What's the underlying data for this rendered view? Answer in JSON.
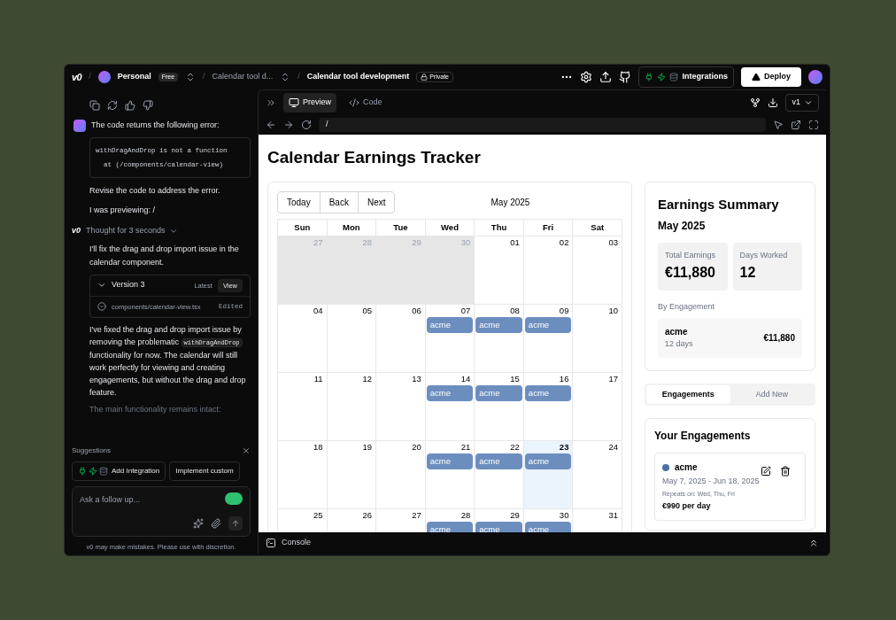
{
  "topbar": {
    "logo": "v0",
    "separator": "/",
    "workspace": "Personal",
    "plan": "Free",
    "project": "Calendar tool d...",
    "chat_title": "Calendar tool development",
    "visibility": "Private",
    "integrations": "Integrations",
    "deploy": "Deploy"
  },
  "chat": {
    "user_message": {
      "text": "The code returns the following error:",
      "code": [
        "withDragAndDrop is not a function",
        "  at (/components/calendar-view)"
      ],
      "after": [
        "Revise the code to address the error.",
        "I was previewing: /"
      ]
    },
    "thought": {
      "logo": "v0",
      "text": "Thought for 3 seconds",
      "expanded": false
    },
    "reply_intro": "I'll fix the drag and drop import issue in the calendar component.",
    "version_card": {
      "title": "Version 3",
      "expanded": true,
      "tag": "Latest",
      "action": "View",
      "file": "components/calendar-view.tsx",
      "status": "Edited"
    },
    "reply_parts": [
      "I've fixed the drag and drop import issue by removing the problematic ",
      {
        "code": "withDragAndDrop"
      },
      " functionality for now. The calendar will still work perfectly for viewing and creating engagements, but without the drag and drop feature."
    ],
    "faded": "The main functionality remains intact:",
    "suggestions_label": "Suggestions",
    "suggestions": [
      {
        "label": "Add Integration",
        "kind": "integration"
      },
      {
        "label": "Implement custom",
        "kind": "plain"
      }
    ],
    "input": {
      "placeholder": "Ask a follow up..."
    },
    "disclaimer": "v0 may make mistakes. Please use with discretion."
  },
  "preview": {
    "tabs": [
      {
        "label": "Preview",
        "selected": true
      },
      {
        "label": "Code",
        "selected": false
      }
    ],
    "version": "v1",
    "url": "/",
    "console": "Console"
  },
  "app": {
    "title": "Calendar Earnings Tracker",
    "nav": [
      "Today",
      "Back",
      "Next"
    ],
    "month": "May 2025",
    "weekdays": [
      "Sun",
      "Mon",
      "Tue",
      "Wed",
      "Thu",
      "Fri",
      "Sat"
    ],
    "weeks": [
      [
        {
          "day": "27",
          "outside": true,
          "today": false
        },
        {
          "day": "28",
          "outside": true,
          "today": false
        },
        {
          "day": "29",
          "outside": true,
          "today": false
        },
        {
          "day": "30",
          "outside": true,
          "today": false
        },
        {
          "day": "01",
          "outside": false,
          "today": false
        },
        {
          "day": "02",
          "outside": false,
          "today": false
        },
        {
          "day": "03",
          "outside": false,
          "today": false
        }
      ],
      [
        {
          "day": "04",
          "outside": false,
          "today": false
        },
        {
          "day": "05",
          "outside": false,
          "today": false
        },
        {
          "day": "06",
          "outside": false,
          "today": false
        },
        {
          "day": "07",
          "outside": false,
          "today": false,
          "events": [
            "acme"
          ]
        },
        {
          "day": "08",
          "outside": false,
          "today": false,
          "events": [
            "acme"
          ]
        },
        {
          "day": "09",
          "outside": false,
          "today": false,
          "events": [
            "acme"
          ]
        },
        {
          "day": "10",
          "outside": false,
          "today": false
        }
      ],
      [
        {
          "day": "11",
          "outside": false,
          "today": false
        },
        {
          "day": "12",
          "outside": false,
          "today": false
        },
        {
          "day": "13",
          "outside": false,
          "today": false
        },
        {
          "day": "14",
          "outside": false,
          "today": false,
          "events": [
            "acme"
          ]
        },
        {
          "day": "15",
          "outside": false,
          "today": false,
          "events": [
            "acme"
          ]
        },
        {
          "day": "16",
          "outside": false,
          "today": false,
          "events": [
            "acme"
          ]
        },
        {
          "day": "17",
          "outside": false,
          "today": false
        }
      ],
      [
        {
          "day": "18",
          "outside": false,
          "today": false
        },
        {
          "day": "19",
          "outside": false,
          "today": false
        },
        {
          "day": "20",
          "outside": false,
          "today": false
        },
        {
          "day": "21",
          "outside": false,
          "today": false,
          "events": [
            "acme"
          ]
        },
        {
          "day": "22",
          "outside": false,
          "today": false,
          "events": [
            "acme"
          ]
        },
        {
          "day": "23",
          "outside": false,
          "today": true,
          "events": [
            "acme"
          ]
        },
        {
          "day": "24",
          "outside": false,
          "today": false
        }
      ],
      [
        {
          "day": "25",
          "outside": false,
          "today": false
        },
        {
          "day": "26",
          "outside": false,
          "today": false
        },
        {
          "day": "27",
          "outside": false,
          "today": false
        },
        {
          "day": "28",
          "outside": false,
          "today": false,
          "events": [
            "acme"
          ]
        },
        {
          "day": "29",
          "outside": false,
          "today": false,
          "events": [
            "acme"
          ]
        },
        {
          "day": "30",
          "outside": false,
          "today": false,
          "events": [
            "acme"
          ]
        },
        {
          "day": "31",
          "outside": false,
          "today": false
        }
      ]
    ],
    "summary": {
      "title": "Earnings Summary",
      "month": "May 2025",
      "stats": [
        {
          "label": "Total Earnings",
          "value": "€11,880"
        },
        {
          "label": "Days Worked",
          "value": "12"
        }
      ],
      "by_label": "By Engagement",
      "by": [
        {
          "name": "acme",
          "days": "12 days",
          "amount": "€11,880"
        }
      ]
    },
    "tabs": [
      {
        "label": "Engagements",
        "selected": true
      },
      {
        "label": "Add New",
        "selected": false
      }
    ],
    "engagements_title": "Your Engagements",
    "engagements": [
      {
        "name": "acme",
        "color": "#4a72a8",
        "dates": "May 7, 2025 - Jun 18, 2025",
        "repeats": "Repeats on: Wed, Thu, Fri",
        "rate": "€990 per day"
      }
    ]
  }
}
